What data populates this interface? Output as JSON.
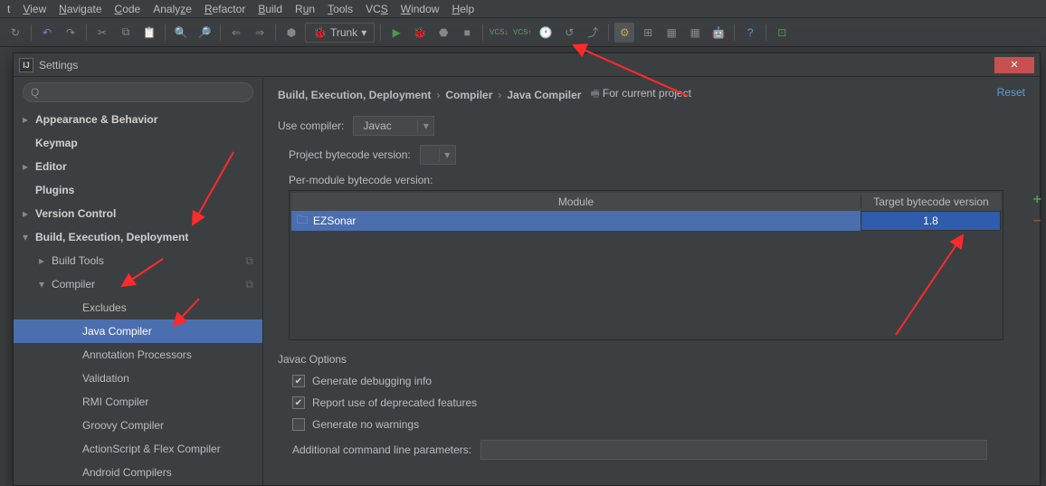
{
  "menu": [
    "Edit",
    "View",
    "Navigate",
    "Code",
    "Analyze",
    "Refactor",
    "Build",
    "Run",
    "Tools",
    "VCS",
    "Window",
    "Help"
  ],
  "trunk_label": "Trunk",
  "dialog_title": "Settings",
  "breadcrumb": [
    "Build, Execution, Deployment",
    "Compiler",
    "Java Compiler"
  ],
  "for_current": "For current project",
  "reset": "Reset",
  "sidebar": {
    "items": [
      {
        "label": "Appearance & Behavior",
        "bold": true,
        "arrow": "▸",
        "indent": 0
      },
      {
        "label": "Keymap",
        "bold": true,
        "arrow": "",
        "indent": 0
      },
      {
        "label": "Editor",
        "bold": true,
        "arrow": "▸",
        "indent": 0
      },
      {
        "label": "Plugins",
        "bold": true,
        "arrow": "",
        "indent": 0
      },
      {
        "label": "Version Control",
        "bold": true,
        "arrow": "▸",
        "indent": 0
      },
      {
        "label": "Build, Execution, Deployment",
        "bold": true,
        "arrow": "▾",
        "indent": 0
      },
      {
        "label": "Build Tools",
        "bold": false,
        "arrow": "▸",
        "indent": 1,
        "copy": true
      },
      {
        "label": "Compiler",
        "bold": false,
        "arrow": "▾",
        "indent": 1,
        "copy": true
      },
      {
        "label": "Excludes",
        "bold": false,
        "arrow": "",
        "indent": 2
      },
      {
        "label": "Java Compiler",
        "bold": false,
        "arrow": "",
        "indent": 2,
        "selected": true
      },
      {
        "label": "Annotation Processors",
        "bold": false,
        "arrow": "",
        "indent": 2
      },
      {
        "label": "Validation",
        "bold": false,
        "arrow": "",
        "indent": 2
      },
      {
        "label": "RMI Compiler",
        "bold": false,
        "arrow": "",
        "indent": 2
      },
      {
        "label": "Groovy Compiler",
        "bold": false,
        "arrow": "",
        "indent": 2
      },
      {
        "label": "ActionScript & Flex Compiler",
        "bold": false,
        "arrow": "",
        "indent": 2
      },
      {
        "label": "Android Compilers",
        "bold": false,
        "arrow": "",
        "indent": 2
      }
    ]
  },
  "main": {
    "use_compiler_label": "Use compiler:",
    "use_compiler_value": "Javac",
    "project_bytecode_label": "Project bytecode version:",
    "project_bytecode_value": "",
    "per_module_label": "Per-module bytecode version:",
    "table": {
      "col_module": "Module",
      "col_target": "Target bytecode version",
      "rows": [
        {
          "module": "EZSonar",
          "target": "1.8"
        }
      ]
    },
    "javac_options": "Javac Options",
    "opt1": "Generate debugging info",
    "opt2": "Report use of deprecated features",
    "opt3": "Generate no warnings",
    "params_label": "Additional command line parameters:",
    "params_value": ""
  }
}
